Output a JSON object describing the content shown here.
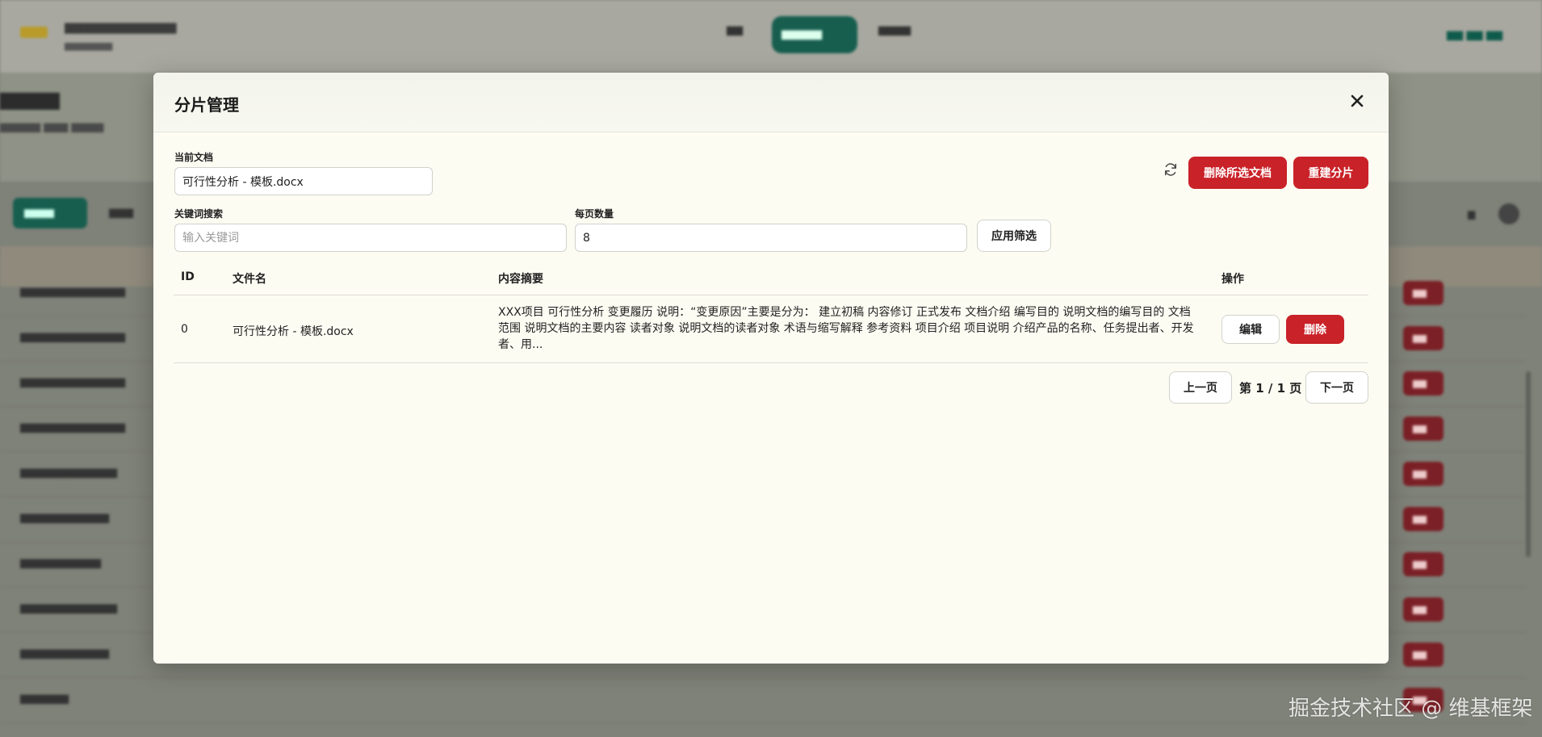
{
  "modal": {
    "title": "分片管理",
    "current_doc_label": "当前文档",
    "current_doc_value": "可行性分析 - 模板.docx",
    "keyword_label": "关键词搜索",
    "keyword_placeholder": "输入关键词",
    "keyword_value": "",
    "page_size_label": "每页数量",
    "page_size_value": "8",
    "apply_filter_label": "应用筛选",
    "delete_selected_label": "删除所选文档",
    "rebuild_label": "重建分片",
    "table": {
      "headers": [
        "ID",
        "文件名",
        "内容摘要",
        "操作"
      ],
      "rows": [
        {
          "id": "0",
          "filename": "可行性分析 - 模板.docx",
          "summary": "XXX项目 可行性分析 变更履历 说明：“变更原因”主要是分为： 建立初稿 内容修订 正式发布 文档介绍 编写目的 说明文档的编写目的 文档范围 说明文档的主要内容 读者对象 说明文档的读者对象 术语与缩写解释 参考资料 项目介绍 项目说明 介绍产品的名称、任务提出者、开发者、用...",
          "edit_label": "编辑",
          "delete_label": "删除"
        }
      ]
    },
    "pagination": {
      "prev_label": "上一页",
      "info": "第 1 / 1 页",
      "next_label": "下一页"
    }
  },
  "watermark": "掘金技术社区 @ 维基框架",
  "colors": {
    "danger": "#c92228",
    "primary_dark": "#175e4f",
    "modal_bg": "#fdfcf3"
  }
}
